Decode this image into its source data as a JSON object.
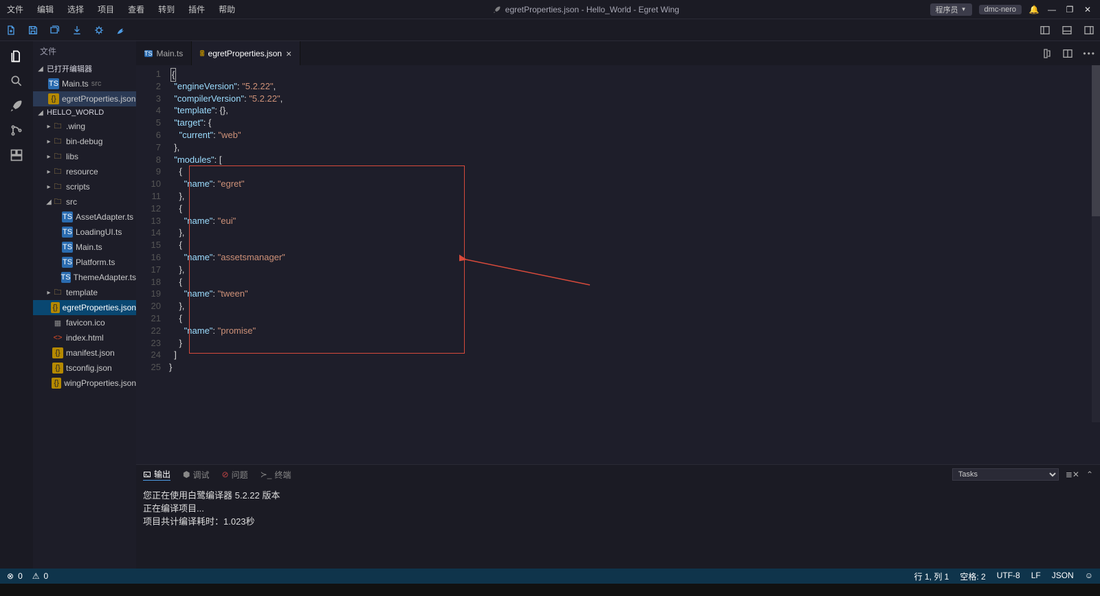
{
  "menubar": {
    "items": [
      "文件",
      "编辑",
      "选择",
      "项目",
      "查看",
      "转到",
      "插件",
      "帮助"
    ],
    "title": "egretProperties.json - Hello_World - Egret Wing"
  },
  "titlebar_right": {
    "role_label": "程序员",
    "user": "dmc-nero"
  },
  "sidebar": {
    "title": "文件",
    "section_open": "已打开编辑器",
    "open_editors": [
      {
        "name": "Main.ts",
        "hint": "src",
        "ftype": "ts"
      },
      {
        "name": "egretProperties.json",
        "ftype": "json"
      }
    ],
    "project_root": "HELLO_WORLD",
    "tree": [
      {
        "name": ".wing",
        "type": "folder",
        "depth": 1,
        "expanded": false
      },
      {
        "name": "bin-debug",
        "type": "folder",
        "depth": 1,
        "expanded": false
      },
      {
        "name": "libs",
        "type": "folder",
        "depth": 1,
        "expanded": false
      },
      {
        "name": "resource",
        "type": "folder",
        "depth": 1,
        "expanded": false
      },
      {
        "name": "scripts",
        "type": "folder",
        "depth": 1,
        "expanded": false
      },
      {
        "name": "src",
        "type": "folder",
        "depth": 1,
        "expanded": true
      },
      {
        "name": "AssetAdapter.ts",
        "type": "ts",
        "depth": 2
      },
      {
        "name": "LoadingUI.ts",
        "type": "ts",
        "depth": 2
      },
      {
        "name": "Main.ts",
        "type": "ts",
        "depth": 2
      },
      {
        "name": "Platform.ts",
        "type": "ts",
        "depth": 2
      },
      {
        "name": "ThemeAdapter.ts",
        "type": "ts",
        "depth": 2
      },
      {
        "name": "template",
        "type": "folder",
        "depth": 1,
        "expanded": false
      },
      {
        "name": "egretProperties.json",
        "type": "json",
        "depth": 1,
        "selected": true
      },
      {
        "name": "favicon.ico",
        "type": "ico",
        "depth": 1
      },
      {
        "name": "index.html",
        "type": "html",
        "depth": 1
      },
      {
        "name": "manifest.json",
        "type": "json",
        "depth": 1
      },
      {
        "name": "tsconfig.json",
        "type": "json",
        "depth": 1
      },
      {
        "name": "wingProperties.json",
        "type": "json",
        "depth": 1
      }
    ]
  },
  "tabs": [
    {
      "label": "Main.ts",
      "ftype": "ts",
      "active": false
    },
    {
      "label": "egretProperties.json",
      "ftype": "json",
      "active": true,
      "closable": true
    }
  ],
  "code": {
    "lines": [
      [
        [
          "punc",
          "{"
        ]
      ],
      [
        [
          "sp",
          "  "
        ],
        [
          "key",
          "\"engineVersion\""
        ],
        [
          "punc",
          ": "
        ],
        [
          "str",
          "\"5.2.22\""
        ],
        [
          "punc",
          ","
        ]
      ],
      [
        [
          "sp",
          "  "
        ],
        [
          "key",
          "\"compilerVersion\""
        ],
        [
          "punc",
          ": "
        ],
        [
          "str",
          "\"5.2.22\""
        ],
        [
          "punc",
          ","
        ]
      ],
      [
        [
          "sp",
          "  "
        ],
        [
          "key",
          "\"template\""
        ],
        [
          "punc",
          ": {},"
        ]
      ],
      [
        [
          "sp",
          "  "
        ],
        [
          "key",
          "\"target\""
        ],
        [
          "punc",
          ": {"
        ]
      ],
      [
        [
          "sp",
          "    "
        ],
        [
          "key",
          "\"current\""
        ],
        [
          "punc",
          ": "
        ],
        [
          "str",
          "\"web\""
        ]
      ],
      [
        [
          "sp",
          "  "
        ],
        [
          "punc",
          "},"
        ]
      ],
      [
        [
          "sp",
          "  "
        ],
        [
          "key",
          "\"modules\""
        ],
        [
          "punc",
          ": ["
        ]
      ],
      [
        [
          "sp",
          "    "
        ],
        [
          "punc",
          "{"
        ]
      ],
      [
        [
          "sp",
          "      "
        ],
        [
          "key",
          "\"name\""
        ],
        [
          "punc",
          ": "
        ],
        [
          "str",
          "\"egret\""
        ]
      ],
      [
        [
          "sp",
          "    "
        ],
        [
          "punc",
          "},"
        ]
      ],
      [
        [
          "sp",
          "    "
        ],
        [
          "punc",
          "{"
        ]
      ],
      [
        [
          "sp",
          "      "
        ],
        [
          "key",
          "\"name\""
        ],
        [
          "punc",
          ": "
        ],
        [
          "str",
          "\"eui\""
        ]
      ],
      [
        [
          "sp",
          "    "
        ],
        [
          "punc",
          "},"
        ]
      ],
      [
        [
          "sp",
          "    "
        ],
        [
          "punc",
          "{"
        ]
      ],
      [
        [
          "sp",
          "      "
        ],
        [
          "key",
          "\"name\""
        ],
        [
          "punc",
          ": "
        ],
        [
          "str",
          "\"assetsmanager\""
        ]
      ],
      [
        [
          "sp",
          "    "
        ],
        [
          "punc",
          "},"
        ]
      ],
      [
        [
          "sp",
          "    "
        ],
        [
          "punc",
          "{"
        ]
      ],
      [
        [
          "sp",
          "      "
        ],
        [
          "key",
          "\"name\""
        ],
        [
          "punc",
          ": "
        ],
        [
          "str",
          "\"tween\""
        ]
      ],
      [
        [
          "sp",
          "    "
        ],
        [
          "punc",
          "},"
        ]
      ],
      [
        [
          "sp",
          "    "
        ],
        [
          "punc",
          "{"
        ]
      ],
      [
        [
          "sp",
          "      "
        ],
        [
          "key",
          "\"name\""
        ],
        [
          "punc",
          ": "
        ],
        [
          "str",
          "\"promise\""
        ]
      ],
      [
        [
          "sp",
          "    "
        ],
        [
          "punc",
          "}"
        ]
      ],
      [
        [
          "sp",
          "  "
        ],
        [
          "punc",
          "]"
        ]
      ],
      [
        [
          "punc",
          "}"
        ]
      ]
    ]
  },
  "panel": {
    "tabs": {
      "output": "输出",
      "debug": "调试",
      "problems": "问题",
      "terminal": "终端"
    },
    "task_select": "Tasks",
    "lines": [
      "您正在使用白鹭编译器 5.2.22 版本",
      "正在编译项目...",
      "项目共计编译耗时：1.023秒"
    ]
  },
  "statusbar": {
    "errors_icon": "⊗",
    "errors": "0",
    "warnings_icon": "⚠",
    "warnings": "0",
    "ln_col": "行 1, 列 1",
    "spaces": "空格: 2",
    "encoding": "UTF-8",
    "eol": "LF",
    "lang": "JSON",
    "smile": "☺"
  }
}
